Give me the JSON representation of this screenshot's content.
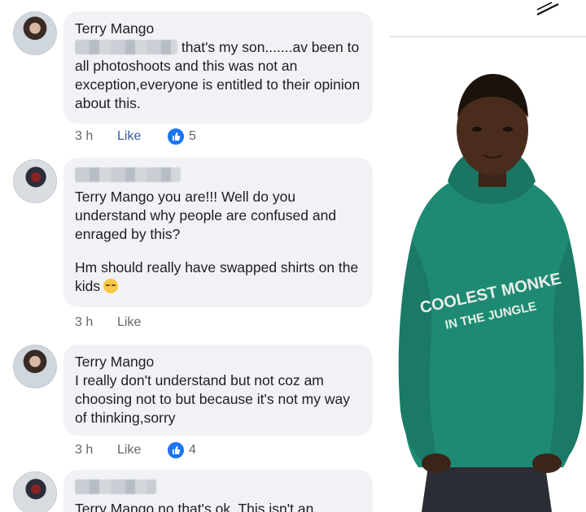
{
  "comments": [
    {
      "author": "Terry Mango",
      "text_after_redaction": "that's my son.......av been",
      "text_rest": "to all photoshoots and this was not an exception,everyone is entitled to their opinion about this.",
      "time": "3 h",
      "like_label": "Like",
      "reaction_count": "5"
    },
    {
      "mention": "Terry Mango",
      "text_line1": " you are!!! Well do you",
      "text_rest": "understand why people are confused and enraged by this?",
      "text_para2": "Hm should really have swapped shirts on the kids",
      "time": "3 h",
      "like_label": "Like"
    },
    {
      "author": "Terry Mango",
      "text": "I really don't understand but not coz am choosing not to but because it's not my way of thinking,sorry",
      "time": "3 h",
      "like_label": "Like",
      "reaction_count": "4"
    },
    {
      "mention": "Terry Mango",
      "text_line1": " no that's ok. This isn't an"
    }
  ],
  "photo": {
    "hoodie_text_line1": "COOLEST MONKE",
    "hoodie_text_line2": "IN THE JUNGLE",
    "hoodie_color": "#1f8a73"
  },
  "colors": {
    "bubble": "#f0f2f5",
    "like_blue": "#385898",
    "react_blue": "#1877f2"
  }
}
